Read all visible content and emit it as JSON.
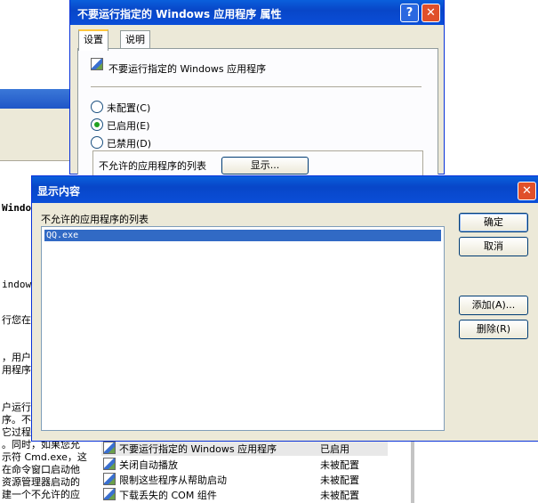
{
  "props_dialog": {
    "title": "不要运行指定的 Windows 应用程序 属性",
    "help_btn": "?",
    "close_btn": "✕",
    "tabs": [
      "设置",
      "说明"
    ],
    "policy_name": "不要运行指定的 Windows 应用程序",
    "radios": [
      {
        "label": "未配置(C)",
        "selected": false
      },
      {
        "label": "已启用(E)",
        "selected": true
      },
      {
        "label": "已禁用(D)",
        "selected": false
      }
    ],
    "option_label": "不允许的应用程序的列表",
    "show_button": "显示..."
  },
  "show_dialog": {
    "title": "显示内容",
    "close_btn": "✕",
    "list_label": "不允许的应用程序的列表",
    "items": [
      "QQ.exe"
    ],
    "ok": "确定",
    "cancel": "取消",
    "add": "添加(A)...",
    "delete": "删除(R)"
  },
  "background": {
    "snippets": [
      "Windo",
      "indows",
      "行您在运",
      "，用户",
      "用程序",
      "户运行",
      "序。不",
      "它过程",
      "。同时，如果您允",
      "示符 Cmd.exe，这",
      "在命令窗口启动他",
      " 资源管理器启动的",
      "建一个不允许的应"
    ],
    "policies": [
      {
        "name": "不要运行指定的 Windows 应用程序",
        "state": "已启用"
      },
      {
        "name": "关闭自动播放",
        "state": "未被配置"
      },
      {
        "name": "限制这些程序从帮助启动",
        "state": "未被配置"
      },
      {
        "name": "下载丢失的 COM 组件",
        "state": "未被配置"
      }
    ]
  }
}
